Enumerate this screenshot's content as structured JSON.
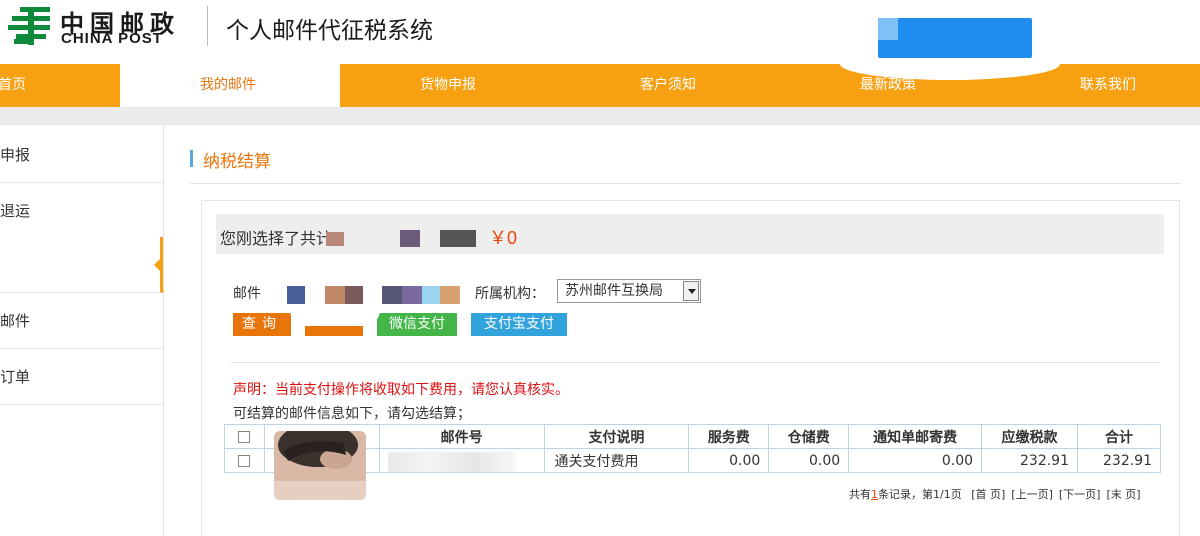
{
  "header": {
    "logo_cn": "中国邮政",
    "logo_en": "CHINA POST",
    "system_title": "个人邮件代征税系统",
    "brand_green": "#0e8a3a"
  },
  "nav": {
    "items": [
      {
        "label": "首页",
        "active": false
      },
      {
        "label": "我的邮件",
        "active": true
      },
      {
        "label": "货物申报",
        "active": false
      },
      {
        "label": "客户须知",
        "active": false
      },
      {
        "label": "最新政策",
        "active": false
      },
      {
        "label": "联系我们",
        "active": false
      }
    ],
    "bg_color": "#f6a012"
  },
  "sidebar": {
    "items": [
      {
        "label": "申报"
      },
      {
        "label": "退运"
      },
      {
        "label": ""
      },
      {
        "label": "邮件"
      },
      {
        "label": "订单"
      }
    ]
  },
  "main": {
    "page_title": "纳税结算",
    "summary": {
      "text": "您刚选择了共计",
      "amount": "￥0"
    },
    "filter": {
      "mail_label": "邮件",
      "org_label": "所属机构：",
      "org_value": "苏州邮件互换局"
    },
    "buttons": {
      "query": "查询",
      "wechat_pay": "微信支付",
      "alipay": "支付宝支付"
    },
    "notice": "声明：当前支付操作将收取如下费用，请您认真核实。",
    "list_caption": "可结算的邮件信息如下，请勾选结算；",
    "table": {
      "headers": [
        "",
        "",
        "邮件号",
        "支付说明",
        "服务费",
        "仓储费",
        "通知单邮寄费",
        "应缴税款",
        "合计"
      ],
      "rows": [
        {
          "mail_no": "",
          "pay_desc": "通关支付费用",
          "service_fee": "0.00",
          "storage_fee": "0.00",
          "notice_postage": "0.00",
          "tax": "232.91",
          "total": "232.91"
        }
      ]
    },
    "pager": {
      "prefix": "共有",
      "count": "1",
      "middle": "条记录，第1/1页",
      "first": "[首 页]",
      "prev": "[上一页]",
      "next": "[下一页]",
      "last": "[末 页]"
    }
  }
}
